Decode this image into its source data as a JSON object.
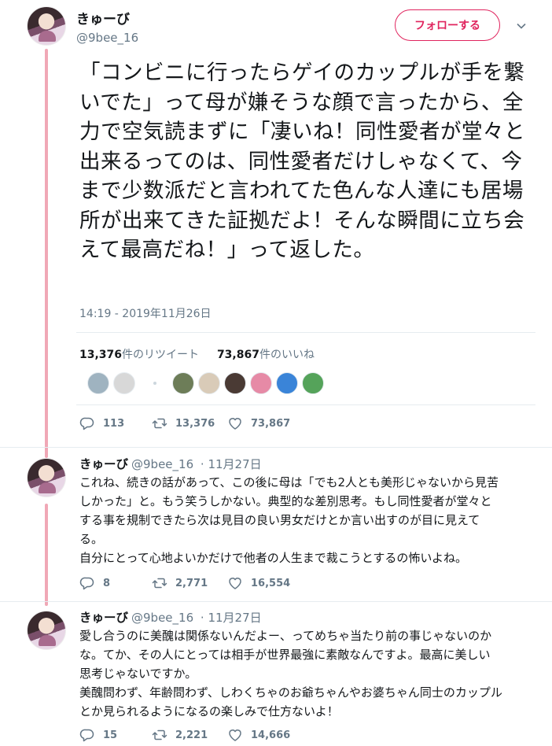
{
  "main": {
    "name": "きゅーび",
    "handle": "@9bee_16",
    "follow_label": "フォローする",
    "text": "「コンビニに行ったらゲイのカップルが手を繋いでた」って母が嫌そうな顔で言ったから、全力で空気読まずに「凄いね！同性愛者が堂々と出来るってのは、同性愛者だけしゃなくて、今まで少数派だと言われてた色んな人達にも居場所が出来てきた証拠だよ！そんな瞬間に立ち会えて最高だね！」って返した。",
    "timestamp": "14:19 - 2019年11月26日",
    "retweets_count": "13,376",
    "retweets_label": "件のリツイート",
    "likes_count": "73,867",
    "likes_label": "件のいいね",
    "actions": {
      "replies": "113",
      "retweets": "13,376",
      "likes": "73,867"
    }
  },
  "likers": [
    {
      "icon": "avatar-mountain-lake",
      "color": "#9fb3c0"
    },
    {
      "icon": "avatar-grey-circle",
      "color": "#d8d8d8"
    },
    {
      "icon": "avatar-game-art",
      "color": "#6d7d58"
    },
    {
      "icon": "avatar-white-flower",
      "color": "#d9cbb8"
    },
    {
      "icon": "avatar-dark-hair-girl",
      "color": "#4a3a34"
    },
    {
      "icon": "avatar-pink-flower",
      "color": "#e68aa6"
    },
    {
      "icon": "avatar-blue-gem",
      "color": "#3a84d8"
    },
    {
      "icon": "avatar-green-drop",
      "color": "#55a35a"
    }
  ],
  "replies": [
    {
      "name": "きゅーび",
      "handle": "@9bee_16",
      "date": "· 11月27日",
      "lines": [
        "これね、続きの話があって、この後に母は「でも2人とも美形じゃないから見苦",
        "しかった」と。もう笑うしかない。典型的な差別思考。もし同性愛者が堂々と",
        "する事を規制できたら次は見目の良い男女だけとか言い出すのが目に見えて",
        "る。",
        "自分にとって心地よいかだけで他者の人生まで裁こうとするの怖いよね。"
      ],
      "actions": {
        "replies": "8",
        "retweets": "2,771",
        "likes": "16,554"
      }
    },
    {
      "name": "きゅーび",
      "handle": "@9bee_16",
      "date": "· 11月27日",
      "lines": [
        "愛し合うのに美醜は関係ないんだよー、ってめちゃ当たり前の事じゃないのか",
        "な。てか、その人にとっては相手が世界最強に素敵なんですよ。最高に美しい",
        "思考じゃないですか。",
        "美醜問わず、年齢問わず、しわくちゃのお爺ちゃんやお婆ちゃん同士のカップル",
        "とか見られるようになるの楽しみで仕方ないよ！"
      ],
      "actions": {
        "replies": "15",
        "retweets": "2,221",
        "likes": "14,666"
      }
    }
  ],
  "colors": {
    "accent": "#e0245e",
    "thread_line": "#f0a8b6",
    "secondary_text": "#657786"
  }
}
